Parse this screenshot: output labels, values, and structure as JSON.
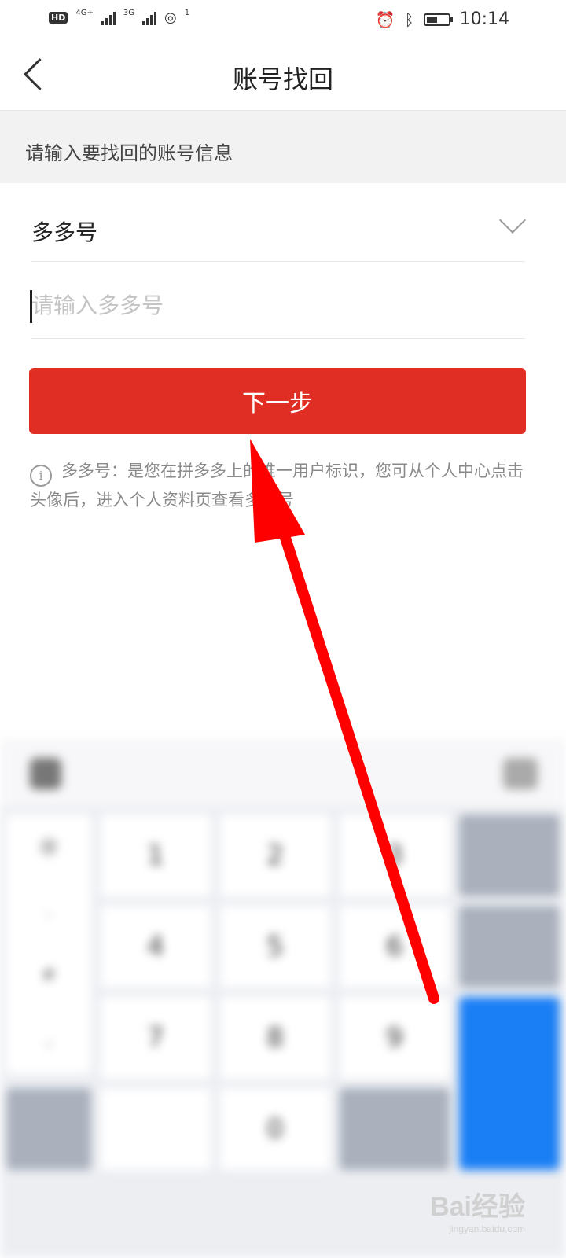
{
  "status_bar": {
    "hd": "HD",
    "network1": "4G+",
    "network2": "3G",
    "hotspot": "1",
    "time": "10:14",
    "battery_level": 0.5
  },
  "nav": {
    "title": "账号找回"
  },
  "section": {
    "header": "请输入要找回的账号信息"
  },
  "form": {
    "account_type": "多多号",
    "input_placeholder": "请输入多多号",
    "next_button": "下一步"
  },
  "hint": {
    "text": "多多号：是您在拼多多上的唯一用户标识，您可从个人中心点击头像后，进入个人资料页查看多多号"
  },
  "keyboard": {
    "digits": [
      "1",
      "2",
      "3",
      "4",
      "5",
      "6",
      "7",
      "8",
      "9",
      "0"
    ]
  },
  "watermark": {
    "logo": "Bai经验",
    "sub": "jingyan.baidu.com"
  },
  "colors": {
    "primary_button": "#e02e24",
    "annotation_arrow": "#ff0000",
    "keyboard_enter": "#1a7ff5"
  }
}
